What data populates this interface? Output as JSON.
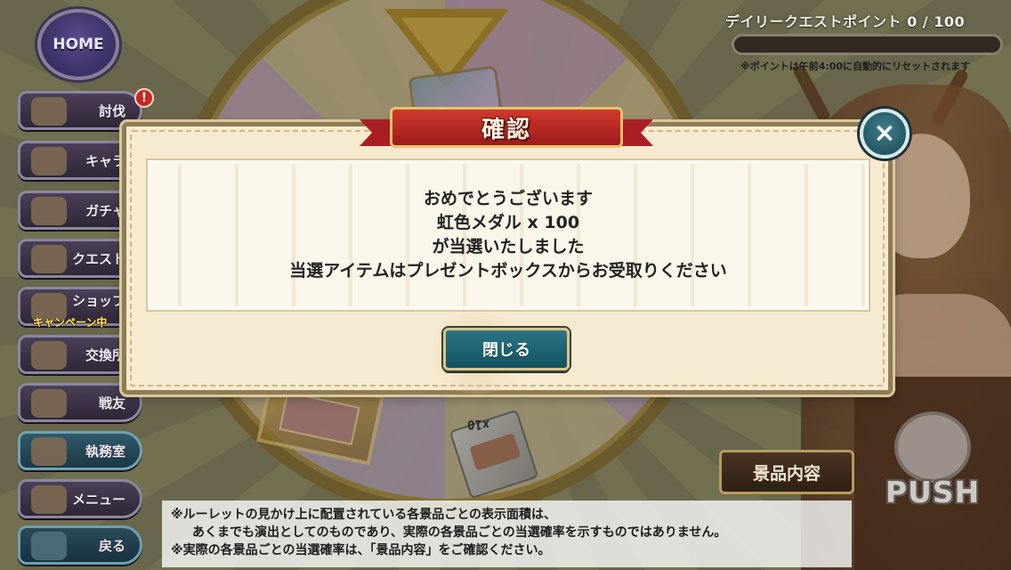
{
  "hud": {
    "home_label": "HOME",
    "daily_title": "デイリークエストポイント 0 / 100",
    "daily_progress": 0,
    "daily_note": "※ポイントは午前4:00に自動的にリセットされます"
  },
  "menu": {
    "items": [
      {
        "label": "討伐",
        "icon": "monster-icon"
      },
      {
        "label": "キャラ",
        "icon": "characters-icon"
      },
      {
        "label": "ガチャ",
        "icon": "flower-pot-icon"
      },
      {
        "label": "クエスト",
        "icon": "quest-map-icon"
      },
      {
        "label": "ショップ",
        "icon": "shop-icon"
      },
      {
        "label": "交換所",
        "icon": "exchange-icon"
      },
      {
        "label": "戦友",
        "icon": "swords-icon"
      },
      {
        "label": "執務室",
        "icon": "office-icon"
      },
      {
        "label": "メニュー",
        "icon": "gear-icon"
      }
    ],
    "alert": "!",
    "campaign": "キャンペーン中",
    "back_label": "戻る"
  },
  "roulette": {
    "chip_count": "x10",
    "prize_button": "景品内容",
    "push_label": "PUSH"
  },
  "notes": {
    "line1": "※ルーレットの見かけ上に配置されている各景品ごとの表示面積は、",
    "line2": "あくまでも演出としてのものであり、実際の各景品ごとの当選確率を示すものではありません。",
    "line3": "※実際の各景品ごとの当選確率は、「景品内容」をご確認ください。"
  },
  "dialog": {
    "title": "確認",
    "message": [
      "おめでとうございます",
      "虹色メダル x 100",
      "が当選いたしました",
      "当選アイテムはプレゼントボックスからお受取りください"
    ],
    "close_button": "閉じる",
    "close_icon": "×"
  },
  "colors": {
    "dialog_bg": "#f6ead0",
    "ribbon": "#b3221f",
    "close_button": "#1f6877"
  }
}
